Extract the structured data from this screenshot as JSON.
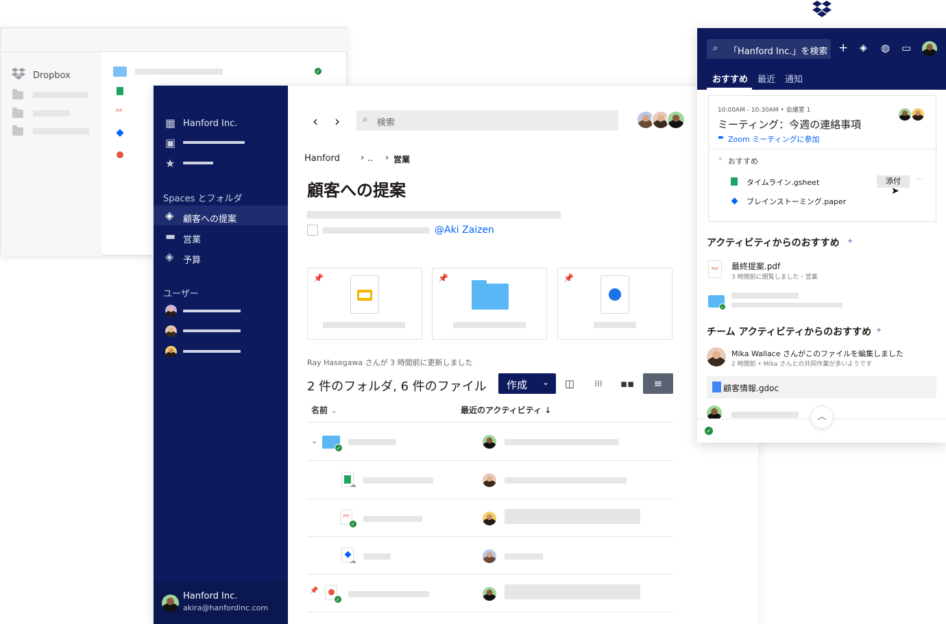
{
  "back_window": {
    "sidebar_label": "Dropbox"
  },
  "sidebar": {
    "team_name": "Hanford Inc.",
    "spaces_heading": "Spaces とフォルダ",
    "spaces": [
      {
        "label": "顧客への提案",
        "icon": "stack-icon"
      },
      {
        "label": "営業",
        "icon": "folder-icon"
      },
      {
        "label": "予算",
        "icon": "shared-stack-icon"
      }
    ],
    "users_heading": "ユーザー",
    "footer": {
      "name": "Hanford Inc.",
      "email": "akira@hanfordinc.com"
    }
  },
  "content": {
    "search_placeholder": "検索",
    "breadcrumb": [
      "Hanford",
      "..",
      "営業"
    ],
    "page_title": "顧客への提案",
    "mention": "@Aki Zaizen",
    "updated_text": "Ray Hasegawa さんが 3 時間前に更新しました",
    "count_text": "2 件のフォルダ, 6 件のファイル",
    "create_label": "作成",
    "columns": {
      "name": "名前",
      "activity": "最近のアクティビティ"
    }
  },
  "panel": {
    "search_label": "「Hanford Inc.」を検索",
    "tabs": [
      "おすすめ",
      "最近",
      "通知"
    ],
    "meeting": {
      "time": "10:00AM - 10:30AM • 会議室 1",
      "title": "ミーティング：今週の連絡事項",
      "zoom_link": "Zoom ミーティングに参加",
      "suggested_label": "おすすめ",
      "files": [
        {
          "name": "タイムライン.gsheet"
        },
        {
          "name": "ブレインストーミング.paper"
        }
      ],
      "attach_label": "添付",
      "more_label": "···"
    },
    "activity_section": {
      "heading": "アクティビティからのおすすめ",
      "file_name": "最終提案.pdf",
      "file_meta": "3 時間前に閲覧しました・営業"
    },
    "team_section": {
      "heading": "チーム アクティビティからのおすすめ",
      "message": "Mika Wallace さんがこのファイルを編集しました",
      "meta": "2 時間前 • Mika さんとの共同作業が多いようです",
      "gdoc_name": "顧客情報.gdoc"
    }
  },
  "colors": {
    "navy": "#0d1b5e",
    "accent_blue": "#0061fe",
    "success_green": "#1f8d3b"
  }
}
